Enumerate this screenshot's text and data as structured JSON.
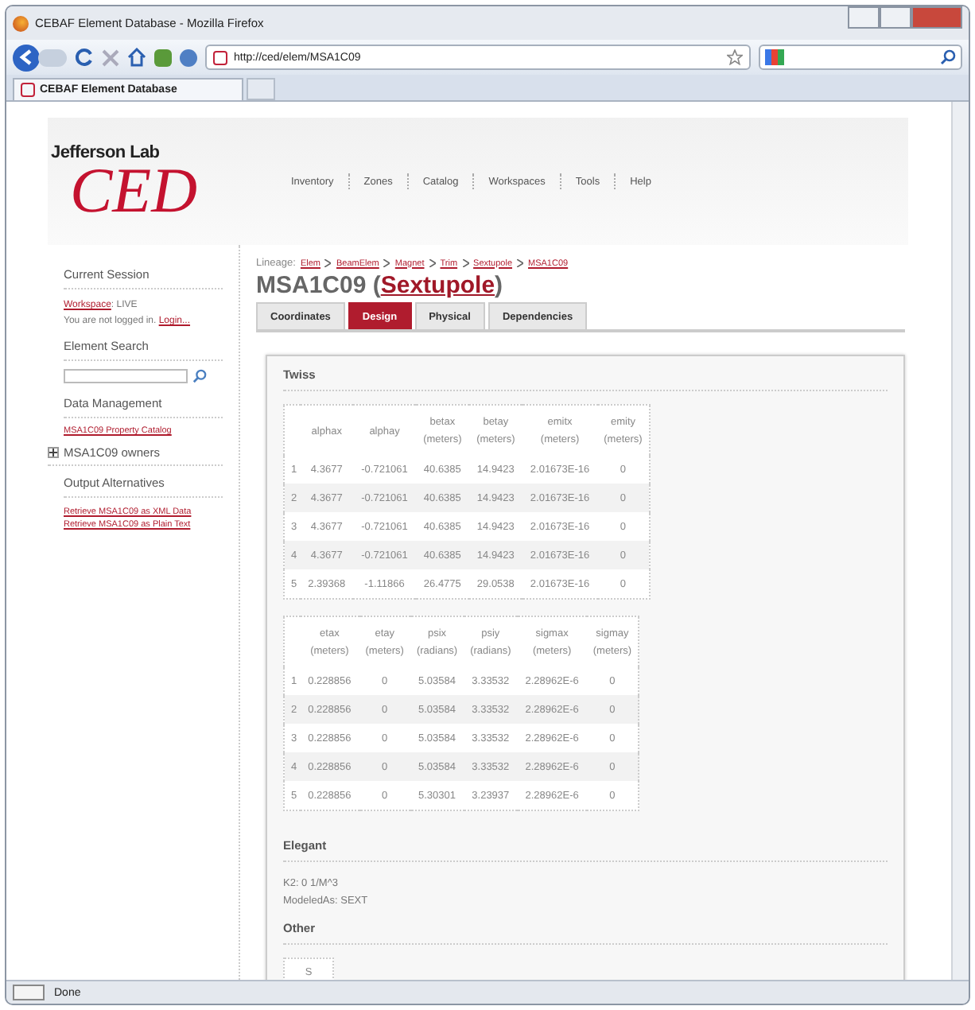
{
  "window": {
    "title": "CEBAF Element Database - Mozilla Firefox",
    "url": "http://ced/elem/MSA1C09",
    "tab_title": "CEBAF Element Database",
    "status": "Done"
  },
  "site": {
    "logo_top": "Jefferson Lab",
    "logo_main": "CED",
    "nav": [
      "Inventory",
      "Zones",
      "Catalog",
      "Workspaces",
      "Tools",
      "Help"
    ]
  },
  "sidebar": {
    "session_title": "Current Session",
    "workspace_link": "Workspace",
    "workspace_value": ": LIVE",
    "login_text": "You are not logged in.",
    "login_link": "Login...",
    "search_title": "Element Search",
    "data_title": "Data Management",
    "catalog_link": "MSA1C09 Property Catalog",
    "owners": {
      "label": "MSA1C09 owners",
      "expanded": false
    },
    "output_title": "Output Alternatives",
    "output_links": [
      "Retrieve MSA1C09 as XML Data",
      "Retrieve MSA1C09 as Plain Text"
    ]
  },
  "lineage": {
    "label": "Lineage:",
    "items": [
      "Elem",
      "BeamElem",
      "Magnet",
      "Trim",
      "Sextupole",
      "MSA1C09"
    ]
  },
  "heading": {
    "prefix": "MSA1C09 (",
    "link": "Sextupole",
    "suffix": ")"
  },
  "tabs": [
    {
      "label": "Coordinates",
      "selected": false
    },
    {
      "label": "Design",
      "selected": true
    },
    {
      "label": "Physical",
      "selected": false
    },
    {
      "label": "Dependencies",
      "selected": false
    }
  ],
  "twiss": {
    "title": "Twiss",
    "tables": [
      {
        "columns": [
          "alphax",
          "alphay",
          "betax (meters)",
          "betay (meters)",
          "emitx (meters)",
          "emity (meters)"
        ],
        "rows": [
          {
            "index": "1",
            "cells": [
              "4.3677",
              "-0.721061",
              "40.6385",
              "14.9423",
              "2.01673E-16",
              "0"
            ]
          },
          {
            "index": "2",
            "cells": [
              "4.3677",
              "-0.721061",
              "40.6385",
              "14.9423",
              "2.01673E-16",
              "0"
            ]
          },
          {
            "index": "3",
            "cells": [
              "4.3677",
              "-0.721061",
              "40.6385",
              "14.9423",
              "2.01673E-16",
              "0"
            ]
          },
          {
            "index": "4",
            "cells": [
              "4.3677",
              "-0.721061",
              "40.6385",
              "14.9423",
              "2.01673E-16",
              "0"
            ]
          },
          {
            "index": "5",
            "cells": [
              "2.39368",
              "-1.11866",
              "26.4775",
              "29.0538",
              "2.01673E-16",
              "0"
            ]
          }
        ]
      },
      {
        "columns": [
          "etax (meters)",
          "etay (meters)",
          "psix (radians)",
          "psiy (radians)",
          "sigmax (meters)",
          "sigmay (meters)"
        ],
        "rows": [
          {
            "index": "1",
            "cells": [
              "0.228856",
              "0",
              "5.03584",
              "3.33532",
              "2.28962E-6",
              "0"
            ]
          },
          {
            "index": "2",
            "cells": [
              "0.228856",
              "0",
              "5.03584",
              "3.33532",
              "2.28962E-6",
              "0"
            ]
          },
          {
            "index": "3",
            "cells": [
              "0.228856",
              "0",
              "5.03584",
              "3.33532",
              "2.28962E-6",
              "0"
            ]
          },
          {
            "index": "4",
            "cells": [
              "0.228856",
              "0",
              "5.03584",
              "3.33532",
              "2.28962E-6",
              "0"
            ]
          },
          {
            "index": "5",
            "cells": [
              "0.228856",
              "0",
              "5.30301",
              "3.23937",
              "2.28962E-6",
              "0"
            ]
          }
        ]
      }
    ]
  },
  "elegant": {
    "title": "Elegant",
    "lines": [
      "K2: 0 1/M^3",
      "ModeledAs: SEXT"
    ]
  },
  "other": {
    "title": "Other",
    "cell": "S"
  }
}
